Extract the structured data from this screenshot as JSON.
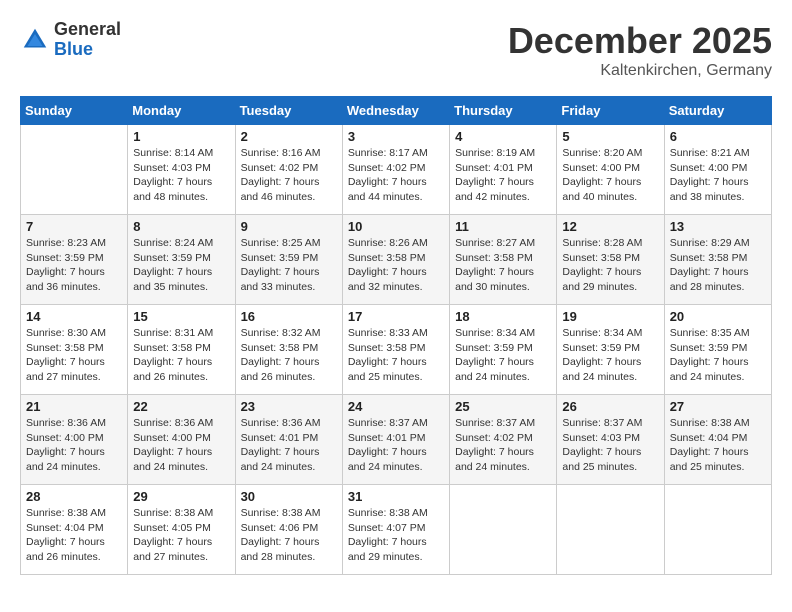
{
  "logo": {
    "general": "General",
    "blue": "Blue"
  },
  "title": "December 2025",
  "location": "Kaltenkirchen, Germany",
  "days_header": [
    "Sunday",
    "Monday",
    "Tuesday",
    "Wednesday",
    "Thursday",
    "Friday",
    "Saturday"
  ],
  "weeks": [
    [
      {
        "day": "",
        "sunrise": "",
        "sunset": "",
        "daylight": ""
      },
      {
        "day": "1",
        "sunrise": "Sunrise: 8:14 AM",
        "sunset": "Sunset: 4:03 PM",
        "daylight": "Daylight: 7 hours and 48 minutes."
      },
      {
        "day": "2",
        "sunrise": "Sunrise: 8:16 AM",
        "sunset": "Sunset: 4:02 PM",
        "daylight": "Daylight: 7 hours and 46 minutes."
      },
      {
        "day": "3",
        "sunrise": "Sunrise: 8:17 AM",
        "sunset": "Sunset: 4:02 PM",
        "daylight": "Daylight: 7 hours and 44 minutes."
      },
      {
        "day": "4",
        "sunrise": "Sunrise: 8:19 AM",
        "sunset": "Sunset: 4:01 PM",
        "daylight": "Daylight: 7 hours and 42 minutes."
      },
      {
        "day": "5",
        "sunrise": "Sunrise: 8:20 AM",
        "sunset": "Sunset: 4:00 PM",
        "daylight": "Daylight: 7 hours and 40 minutes."
      },
      {
        "day": "6",
        "sunrise": "Sunrise: 8:21 AM",
        "sunset": "Sunset: 4:00 PM",
        "daylight": "Daylight: 7 hours and 38 minutes."
      }
    ],
    [
      {
        "day": "7",
        "sunrise": "Sunrise: 8:23 AM",
        "sunset": "Sunset: 3:59 PM",
        "daylight": "Daylight: 7 hours and 36 minutes."
      },
      {
        "day": "8",
        "sunrise": "Sunrise: 8:24 AM",
        "sunset": "Sunset: 3:59 PM",
        "daylight": "Daylight: 7 hours and 35 minutes."
      },
      {
        "day": "9",
        "sunrise": "Sunrise: 8:25 AM",
        "sunset": "Sunset: 3:59 PM",
        "daylight": "Daylight: 7 hours and 33 minutes."
      },
      {
        "day": "10",
        "sunrise": "Sunrise: 8:26 AM",
        "sunset": "Sunset: 3:58 PM",
        "daylight": "Daylight: 7 hours and 32 minutes."
      },
      {
        "day": "11",
        "sunrise": "Sunrise: 8:27 AM",
        "sunset": "Sunset: 3:58 PM",
        "daylight": "Daylight: 7 hours and 30 minutes."
      },
      {
        "day": "12",
        "sunrise": "Sunrise: 8:28 AM",
        "sunset": "Sunset: 3:58 PM",
        "daylight": "Daylight: 7 hours and 29 minutes."
      },
      {
        "day": "13",
        "sunrise": "Sunrise: 8:29 AM",
        "sunset": "Sunset: 3:58 PM",
        "daylight": "Daylight: 7 hours and 28 minutes."
      }
    ],
    [
      {
        "day": "14",
        "sunrise": "Sunrise: 8:30 AM",
        "sunset": "Sunset: 3:58 PM",
        "daylight": "Daylight: 7 hours and 27 minutes."
      },
      {
        "day": "15",
        "sunrise": "Sunrise: 8:31 AM",
        "sunset": "Sunset: 3:58 PM",
        "daylight": "Daylight: 7 hours and 26 minutes."
      },
      {
        "day": "16",
        "sunrise": "Sunrise: 8:32 AM",
        "sunset": "Sunset: 3:58 PM",
        "daylight": "Daylight: 7 hours and 26 minutes."
      },
      {
        "day": "17",
        "sunrise": "Sunrise: 8:33 AM",
        "sunset": "Sunset: 3:58 PM",
        "daylight": "Daylight: 7 hours and 25 minutes."
      },
      {
        "day": "18",
        "sunrise": "Sunrise: 8:34 AM",
        "sunset": "Sunset: 3:59 PM",
        "daylight": "Daylight: 7 hours and 24 minutes."
      },
      {
        "day": "19",
        "sunrise": "Sunrise: 8:34 AM",
        "sunset": "Sunset: 3:59 PM",
        "daylight": "Daylight: 7 hours and 24 minutes."
      },
      {
        "day": "20",
        "sunrise": "Sunrise: 8:35 AM",
        "sunset": "Sunset: 3:59 PM",
        "daylight": "Daylight: 7 hours and 24 minutes."
      }
    ],
    [
      {
        "day": "21",
        "sunrise": "Sunrise: 8:36 AM",
        "sunset": "Sunset: 4:00 PM",
        "daylight": "Daylight: 7 hours and 24 minutes."
      },
      {
        "day": "22",
        "sunrise": "Sunrise: 8:36 AM",
        "sunset": "Sunset: 4:00 PM",
        "daylight": "Daylight: 7 hours and 24 minutes."
      },
      {
        "day": "23",
        "sunrise": "Sunrise: 8:36 AM",
        "sunset": "Sunset: 4:01 PM",
        "daylight": "Daylight: 7 hours and 24 minutes."
      },
      {
        "day": "24",
        "sunrise": "Sunrise: 8:37 AM",
        "sunset": "Sunset: 4:01 PM",
        "daylight": "Daylight: 7 hours and 24 minutes."
      },
      {
        "day": "25",
        "sunrise": "Sunrise: 8:37 AM",
        "sunset": "Sunset: 4:02 PM",
        "daylight": "Daylight: 7 hours and 24 minutes."
      },
      {
        "day": "26",
        "sunrise": "Sunrise: 8:37 AM",
        "sunset": "Sunset: 4:03 PM",
        "daylight": "Daylight: 7 hours and 25 minutes."
      },
      {
        "day": "27",
        "sunrise": "Sunrise: 8:38 AM",
        "sunset": "Sunset: 4:04 PM",
        "daylight": "Daylight: 7 hours and 25 minutes."
      }
    ],
    [
      {
        "day": "28",
        "sunrise": "Sunrise: 8:38 AM",
        "sunset": "Sunset: 4:04 PM",
        "daylight": "Daylight: 7 hours and 26 minutes."
      },
      {
        "day": "29",
        "sunrise": "Sunrise: 8:38 AM",
        "sunset": "Sunset: 4:05 PM",
        "daylight": "Daylight: 7 hours and 27 minutes."
      },
      {
        "day": "30",
        "sunrise": "Sunrise: 8:38 AM",
        "sunset": "Sunset: 4:06 PM",
        "daylight": "Daylight: 7 hours and 28 minutes."
      },
      {
        "day": "31",
        "sunrise": "Sunrise: 8:38 AM",
        "sunset": "Sunset: 4:07 PM",
        "daylight": "Daylight: 7 hours and 29 minutes."
      },
      {
        "day": "",
        "sunrise": "",
        "sunset": "",
        "daylight": ""
      },
      {
        "day": "",
        "sunrise": "",
        "sunset": "",
        "daylight": ""
      },
      {
        "day": "",
        "sunrise": "",
        "sunset": "",
        "daylight": ""
      }
    ]
  ]
}
